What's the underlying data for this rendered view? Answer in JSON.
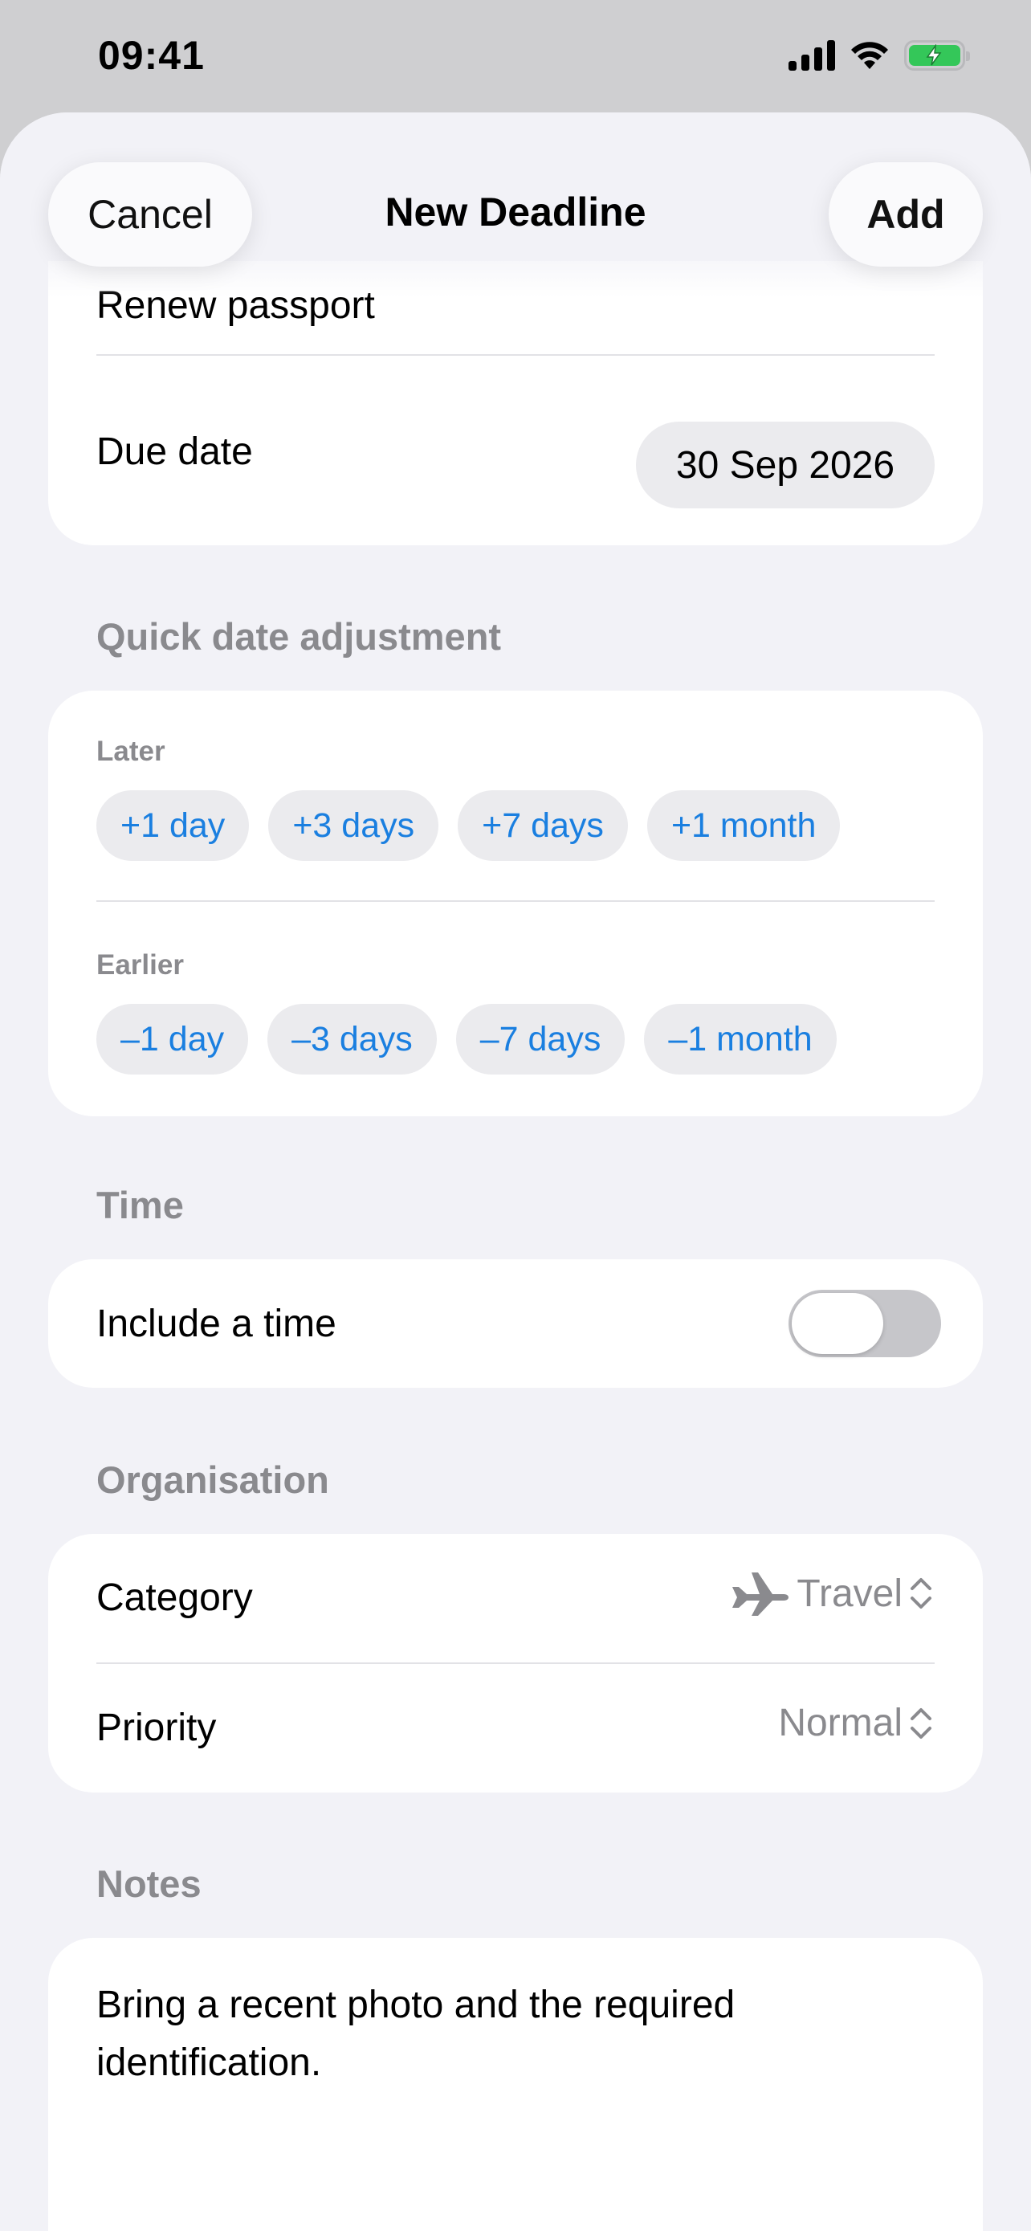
{
  "status_bar": {
    "time": "09:41"
  },
  "nav": {
    "cancel_label": "Cancel",
    "title": "New Deadline",
    "add_label": "Add"
  },
  "details": {
    "title_value": "Renew passport",
    "due_date_label": "Due date",
    "due_date_value": "30 Sep 2026"
  },
  "quick_adjust": {
    "header": "Quick date adjustment",
    "later_label": "Later",
    "later_chips": [
      "+1 day",
      "+3 days",
      "+7 days",
      "+1 month"
    ],
    "earlier_label": "Earlier",
    "earlier_chips": [
      "–1 day",
      "–3 days",
      "–7 days",
      "–1 month"
    ]
  },
  "time_section": {
    "header": "Time",
    "include_time_label": "Include a time",
    "include_time_on": false
  },
  "organisation": {
    "header": "Organisation",
    "category_label": "Category",
    "category_value": "Travel",
    "category_icon": "airplane-icon",
    "priority_label": "Priority",
    "priority_value": "Normal"
  },
  "notes": {
    "header": "Notes",
    "text": "Bring a recent photo and the required identification."
  },
  "colors": {
    "accent": "#1a7fe0",
    "background": "#f2f2f7",
    "battery": "#34c759"
  }
}
